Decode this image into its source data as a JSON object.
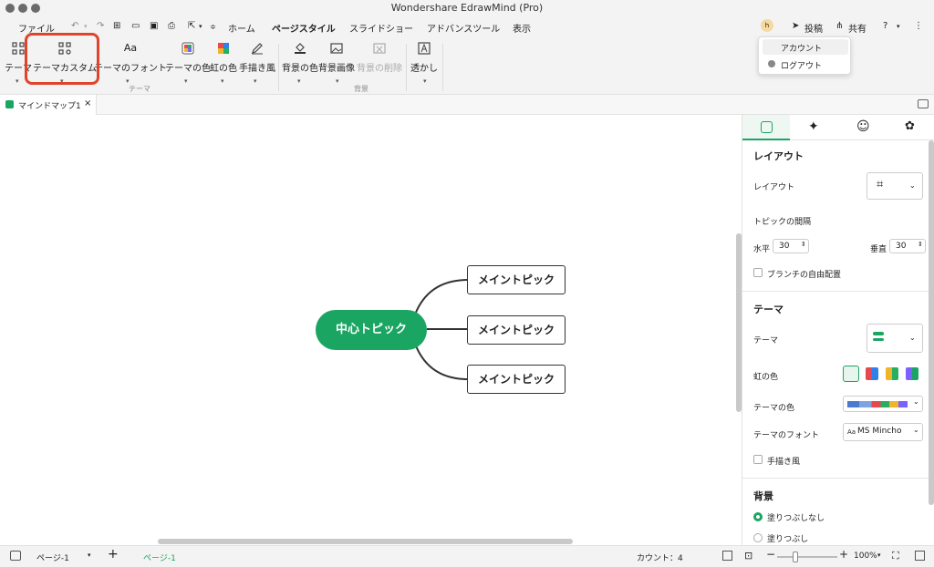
{
  "app": {
    "title": "Wondershare EdrawMind (Pro)"
  },
  "menu": {
    "file": "ファイル",
    "home": "ホーム",
    "page_style": "ページスタイル",
    "slideshow": "スライドショー",
    "advanced": "アドバンスツール",
    "view": "表示",
    "publish": "投稿",
    "share": "共有",
    "avatar_initial": "h"
  },
  "account_menu": {
    "account": "アカウント",
    "logout": "ログアウト"
  },
  "ribbon": {
    "theme": "テーマ",
    "theme_custom": "テーマカスタム",
    "theme_font": "テーマのフォント",
    "theme_color": "テーマの色",
    "rainbow_color": "虹の色",
    "hand_drawn": "手描き風",
    "bg_color": "背景の色",
    "bg_image": "背景画像",
    "bg_delete": "背景の削除",
    "watermark": "透かし",
    "group_theme": "テーマ",
    "group_bg": "背景"
  },
  "doc_tab": {
    "label": "マインドマップ1"
  },
  "mindmap": {
    "central": "中心トピック",
    "topics": [
      "メイントピック",
      "メイントピック",
      "メイントピック"
    ]
  },
  "panel": {
    "layout_section": "レイアウト",
    "layout_label": "レイアウト",
    "spacing_label": "トピックの間隔",
    "horizontal_label": "水平",
    "horizontal_value": "30",
    "vertical_label": "垂直",
    "vertical_value": "30",
    "free_branch": "ブランチの自由配置",
    "theme_section": "テーマ",
    "theme_label": "テーマ",
    "rainbow_label": "虹の色",
    "theme_color_label": "テーマの色",
    "theme_font_label": "テーマのフォント",
    "font_icon": "Aa",
    "font_value": "MS Mincho",
    "hand_drawn": "手描き風",
    "bg_section": "背景",
    "no_fill": "塗りつぶしなし",
    "fill": "塗りつぶし"
  },
  "status": {
    "page_select": "ページ-1",
    "page_tab": "ページ-1",
    "count": "カウント：4",
    "zoom": "100%"
  },
  "colors": {
    "accent": "#1aa562",
    "highlight": "#e0452c",
    "chrome": "#f3f3f3"
  }
}
